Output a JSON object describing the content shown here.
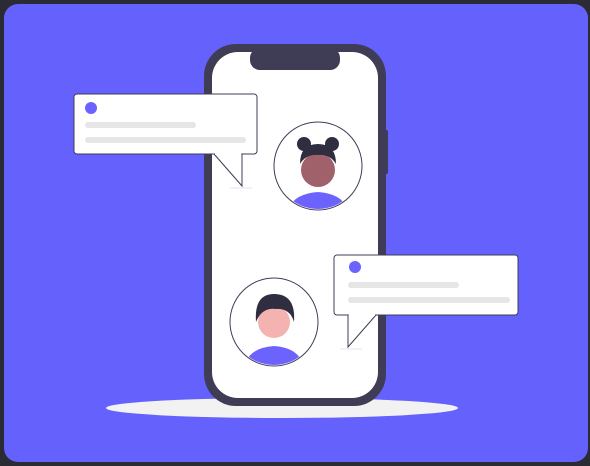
{
  "illustration": {
    "subject": "chat-conversation",
    "colors": {
      "page_background": "#2a2b33",
      "panel_background": "#6461fc",
      "phone_frame": "#3f3d56",
      "phone_screen": "#ffffff",
      "shadow": "#f2f2f2",
      "bubble_fill": "#ffffff",
      "bubble_stroke": "#3f3d56",
      "bubble_line": "#e6e6e6",
      "accent": "#6c63ff",
      "skin_dark": "#a0616a",
      "skin_light": "#f4b3b0",
      "hair": "#2f2e41"
    }
  }
}
